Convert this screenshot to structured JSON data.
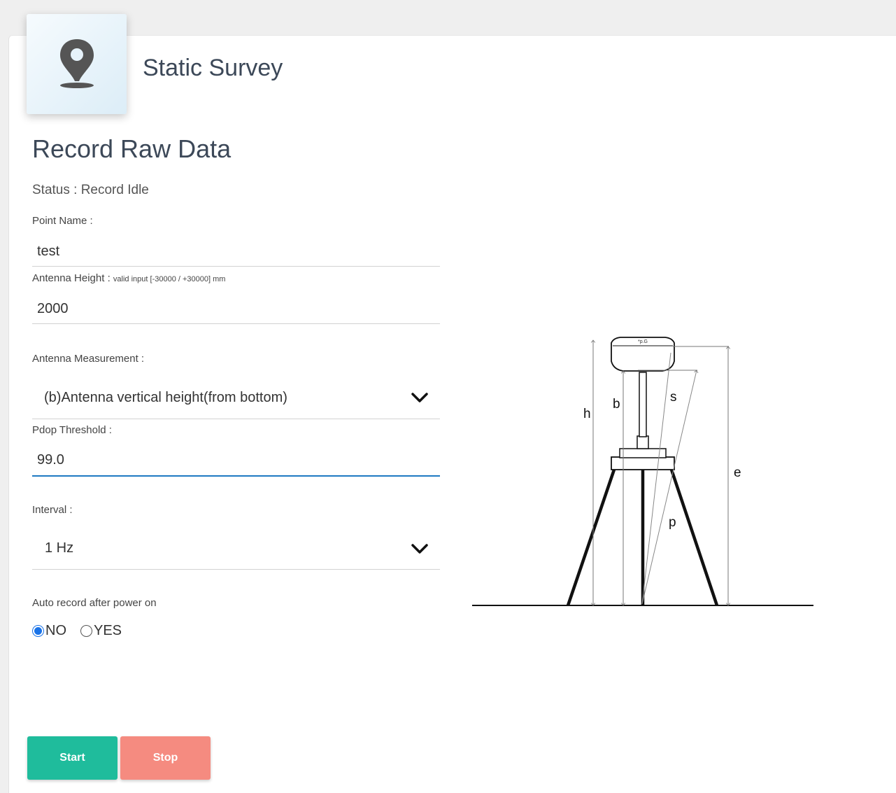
{
  "header": {
    "icon": "map-pin-icon",
    "title": "Static Survey"
  },
  "section": {
    "title": "Record Raw Data",
    "status": "Status : Record Idle"
  },
  "point_name": {
    "label": "Point Name :",
    "value": "test"
  },
  "antenna_height": {
    "label": "Antenna Height : ",
    "hint": "valid input [-30000 / +30000] mm",
    "value": "2000"
  },
  "antenna_measurement": {
    "label": "Antenna Measurement :",
    "selected": "(b)Antenna vertical height(from bottom)"
  },
  "pdop": {
    "label": "Pdop Threshold :",
    "value": "99.0"
  },
  "interval": {
    "label": "Interval :",
    "selected": "1 Hz"
  },
  "auto_record": {
    "label": "Auto record after power on",
    "options": [
      "NO",
      "YES"
    ],
    "selected": "NO"
  },
  "diagram": {
    "labels": {
      "h": "h",
      "b": "b",
      "s": "s",
      "e": "e",
      "p": "p"
    },
    "receiver_text": "*p.G"
  },
  "buttons": {
    "start": "Start",
    "stop": "Stop"
  },
  "colors": {
    "start": "#1fbc9c",
    "stop": "#f58b80",
    "focus_underline": "#1e7ac2",
    "radio_checked": "#1a73e8"
  }
}
